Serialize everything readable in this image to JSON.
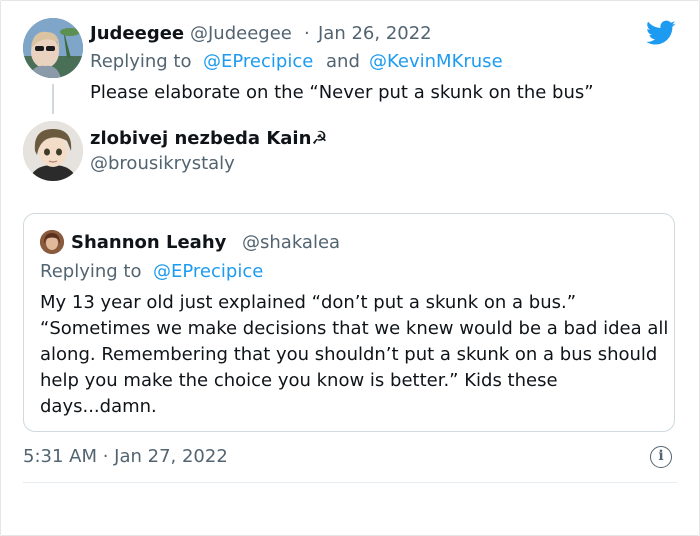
{
  "brand": {
    "icon": "twitter-bird-icon",
    "color": "#1d9bf0"
  },
  "reply_tweet": {
    "display_name": "Judeegee",
    "handle": "@Judeegee",
    "separator": "·",
    "date": "Jan 26, 2022",
    "replying_prefix": "Replying to",
    "replying_to_1": "@EPrecipice",
    "replying_and": "and",
    "replying_to_2": "@KevinMKruse",
    "text": "Please elaborate on the “Never put a skunk on the bus”"
  },
  "main_tweet": {
    "display_name": "zlobivej nezbeda Kain☭",
    "handle": "@brousikrystaly",
    "quoted": {
      "display_name": "Shannon Leahy",
      "handle": "@shakalea",
      "replying_prefix": "Replying to",
      "replying_to": "@EPrecipice",
      "text": "My 13 year old just explained “don’t put a skunk on a bus.” “Sometimes we make decisions that we knew would be a bad idea all along. Remembering that you shouldn’t put a skunk on a bus should help you make the choice you know is better.” Kids these days...damn."
    },
    "timestamp": "5:31 AM · Jan 27, 2022",
    "info_icon_glyph": "i"
  },
  "colors": {
    "text": "#0f1419",
    "secondary": "#536471",
    "link": "#1d9bf0",
    "border": "#cfd9de"
  }
}
